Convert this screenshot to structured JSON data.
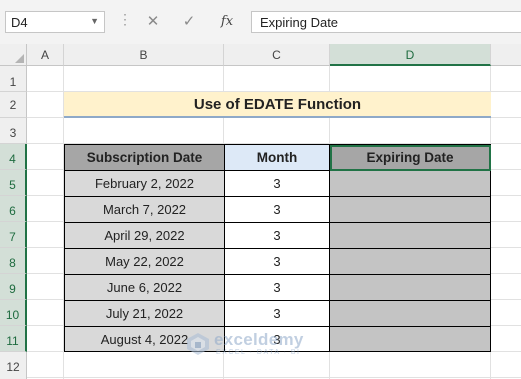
{
  "formula_bar": {
    "name_box": "D4",
    "cancel_icon": "✕",
    "enter_icon": "✓",
    "fx_label": "fx",
    "formula": "Expiring Date"
  },
  "columns": [
    "A",
    "B",
    "C",
    "D"
  ],
  "rows": [
    "1",
    "2",
    "3",
    "4",
    "5",
    "6",
    "7",
    "8",
    "9",
    "10",
    "11",
    "12"
  ],
  "title": "Use of EDATE Function",
  "table": {
    "headers": [
      "Subscription Date",
      "Month",
      "Expiring Date"
    ],
    "rows": [
      [
        "February 2, 2022",
        "3",
        ""
      ],
      [
        "March 7, 2022",
        "3",
        ""
      ],
      [
        "April 29, 2022",
        "3",
        ""
      ],
      [
        "May 22, 2022",
        "3",
        ""
      ],
      [
        "June 6, 2022",
        "3",
        ""
      ],
      [
        "July 21, 2022",
        "3",
        ""
      ],
      [
        "August 4, 2022",
        "3",
        ""
      ]
    ]
  },
  "watermark": {
    "name": "exceldemy",
    "tagline": "EXCEL · DATA · BI"
  },
  "colors": {
    "title_fill": "#fff2cc",
    "header_gray": "#a6a6a6",
    "header_blue": "#dde9f7",
    "selection_green": "#217346"
  }
}
